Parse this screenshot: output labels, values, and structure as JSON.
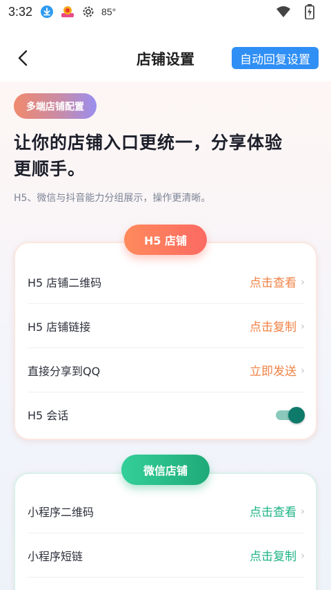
{
  "status_bar": {
    "time": "3:32",
    "temperature": "85°",
    "icons": [
      "download-icon",
      "app-notification-icon",
      "gear-icon",
      "wifi-icon",
      "battery-icon"
    ]
  },
  "header": {
    "title": "店铺设置",
    "auto_reply_label": "自动回复设置"
  },
  "intro": {
    "tag": "多端店铺配置",
    "headline_line1": "让你的店铺入口更统一，分享体验",
    "headline_line2": "更顺手。",
    "subline": "H5、微信与抖音能力分组展示，操作更清晰。"
  },
  "sections": {
    "h5": {
      "badge": "H5 店铺",
      "rows": [
        {
          "label": "H5 店铺二维码",
          "action": "点击查看"
        },
        {
          "label": "H5 店铺链接",
          "action": "点击复制"
        },
        {
          "label": "直接分享到QQ",
          "action": "立即发送"
        },
        {
          "label": "H5 会话",
          "toggle_on": true
        }
      ]
    },
    "wechat": {
      "badge": "微信店铺",
      "rows": [
        {
          "label": "小程序二维码",
          "action": "点击查看"
        },
        {
          "label": "小程序短链",
          "action": "点击复制"
        }
      ]
    }
  },
  "colors": {
    "accent_blue": "#2f8ff5",
    "h5_accent": "#f08245",
    "wechat_accent": "#1eb385",
    "toggle_on": "#0d7a6a"
  }
}
